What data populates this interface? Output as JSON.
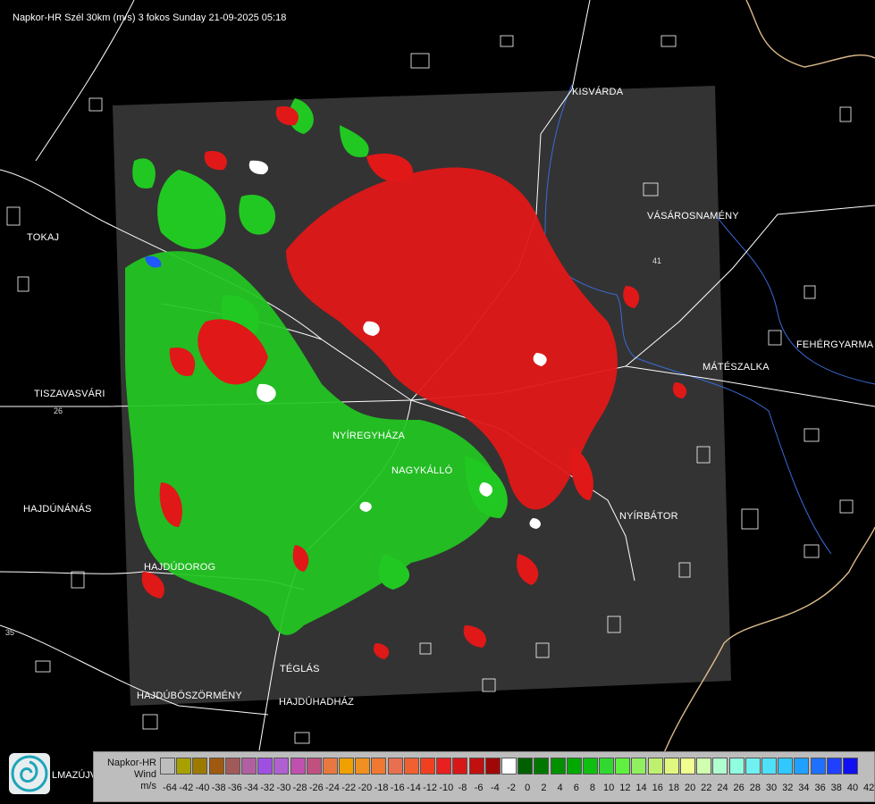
{
  "title": "Napkor-HR Szél 30km (m/s) 3 fokos Sunday 21-09-2025 05:18",
  "cities": [
    {
      "id": "kisvarda",
      "name": "KISVÁRDA"
    },
    {
      "id": "tokaj",
      "name": "TOKAJ"
    },
    {
      "id": "vasarosnameny",
      "name": "VÁSÁROSNAMÉNY"
    },
    {
      "id": "fehergyarmat",
      "name": "FEHÉRGYARMA"
    },
    {
      "id": "mateszalka",
      "name": "MÁTÉSZALKA"
    },
    {
      "id": "tiszavasvari",
      "name": "TISZAVASVÁRI"
    },
    {
      "id": "nyiregyhaza",
      "name": "NYÍREGYHÁZA"
    },
    {
      "id": "nagykallo",
      "name": "NAGYKÁLLÓ"
    },
    {
      "id": "nyirbator",
      "name": "NYÍRBÁTOR"
    },
    {
      "id": "hajdunanas",
      "name": "HAJDÚNÁNÁS"
    },
    {
      "id": "hajdudorog",
      "name": "HAJDÚDOROG"
    },
    {
      "id": "teglas",
      "name": "TÉGLÁS"
    },
    {
      "id": "hajduboszormeny",
      "name": "HAJDÚBÖSZÖRMÉNY"
    },
    {
      "id": "hajduhadhaz",
      "name": "HAJDÚHADHÁZ"
    },
    {
      "id": "hmazujvar",
      "name": "LMAZÚJVÁR"
    }
  ],
  "road_numbers": [
    "26",
    "41",
    "35"
  ],
  "legend": {
    "title_lines": [
      "Napkor-HR",
      "Wind",
      "m/s"
    ],
    "ticks": [
      "-64",
      "-42",
      "-40",
      "-38",
      "-36",
      "-34",
      "-32",
      "-30",
      "-28",
      "-26",
      "-24",
      "-22",
      "-20",
      "-18",
      "-16",
      "-14",
      "-12",
      "-10",
      "-8",
      "-6",
      "-4",
      "-2",
      "0",
      "2",
      "4",
      "6",
      "8",
      "10",
      "12",
      "14",
      "16",
      "18",
      "20",
      "22",
      "24",
      "26",
      "28",
      "30",
      "32",
      "34",
      "36",
      "38",
      "40",
      "42"
    ],
    "colors": [
      "#bdbdbd",
      "#a8a000",
      "#9c7a00",
      "#a05a10",
      "#a05a5a",
      "#b060a0",
      "#a050e0",
      "#b060d0",
      "#c050b0",
      "#c05080",
      "#e87840",
      "#f0a000",
      "#f09020",
      "#f07830",
      "#e87050",
      "#f06030",
      "#f04020",
      "#e82020",
      "#d81818",
      "#c01010",
      "#a00808",
      "#ffffff",
      "#006000",
      "#007800",
      "#009000",
      "#00a800",
      "#10c010",
      "#30d830",
      "#60f040",
      "#90f060",
      "#c0f070",
      "#e0f880",
      "#f0ff90",
      "#d0ffb0",
      "#b0ffd0",
      "#90ffe0",
      "#70f0f0",
      "#50e0f8",
      "#30c8ff",
      "#20a0ff",
      "#2070ff",
      "#2040ff",
      "#1010f0"
    ]
  }
}
